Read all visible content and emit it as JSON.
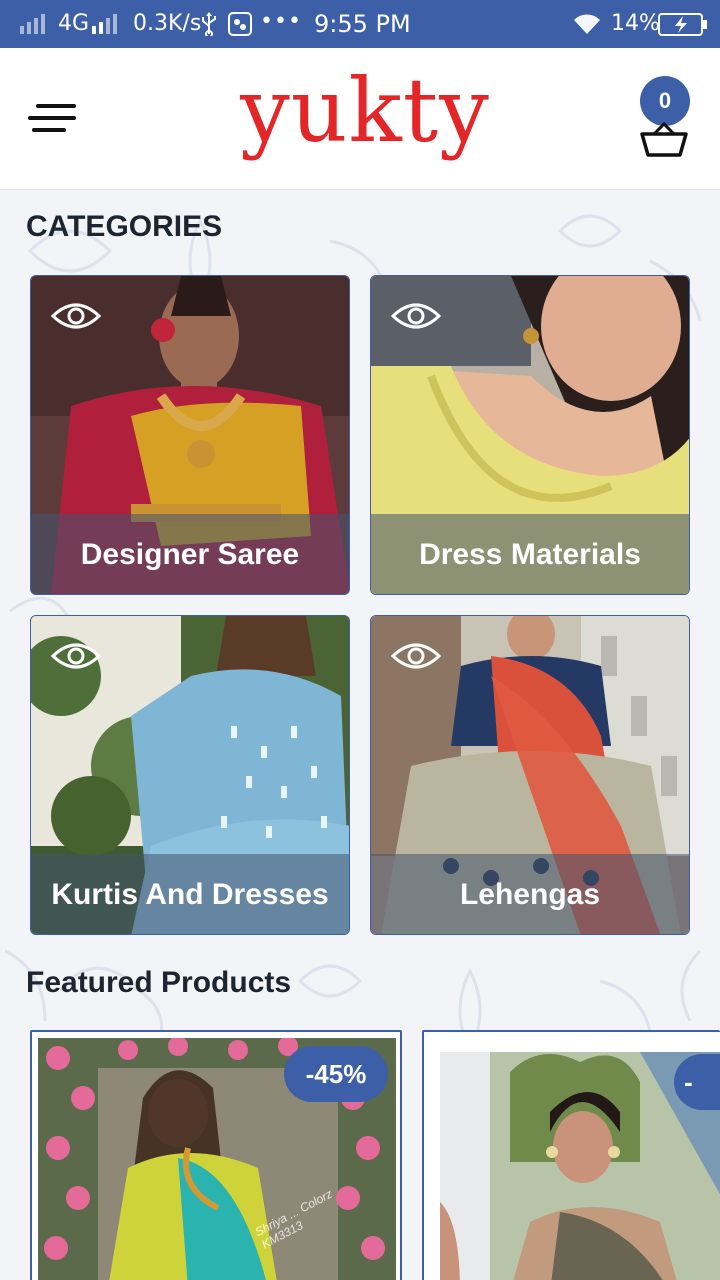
{
  "status_bar": {
    "network": "4G",
    "speed": "0.3K/s",
    "time": "9:55 PM",
    "battery": "14%",
    "more": "•••"
  },
  "header": {
    "logo": "yukty",
    "cart_count": "0",
    "brand_color": "#e32628",
    "accent_color": "#3d5fa8"
  },
  "categories": {
    "title": "CATEGORIES",
    "items": [
      {
        "label": "Designer Saree"
      },
      {
        "label": "Dress Materials"
      },
      {
        "label": "Kurtis And Dresses"
      },
      {
        "label": "Lehengas"
      }
    ]
  },
  "featured": {
    "title": "Featured Products",
    "items": [
      {
        "discount": "-45%",
        "watermark": "Shriya ... Colorz KM3313"
      },
      {
        "discount": "-"
      }
    ]
  }
}
